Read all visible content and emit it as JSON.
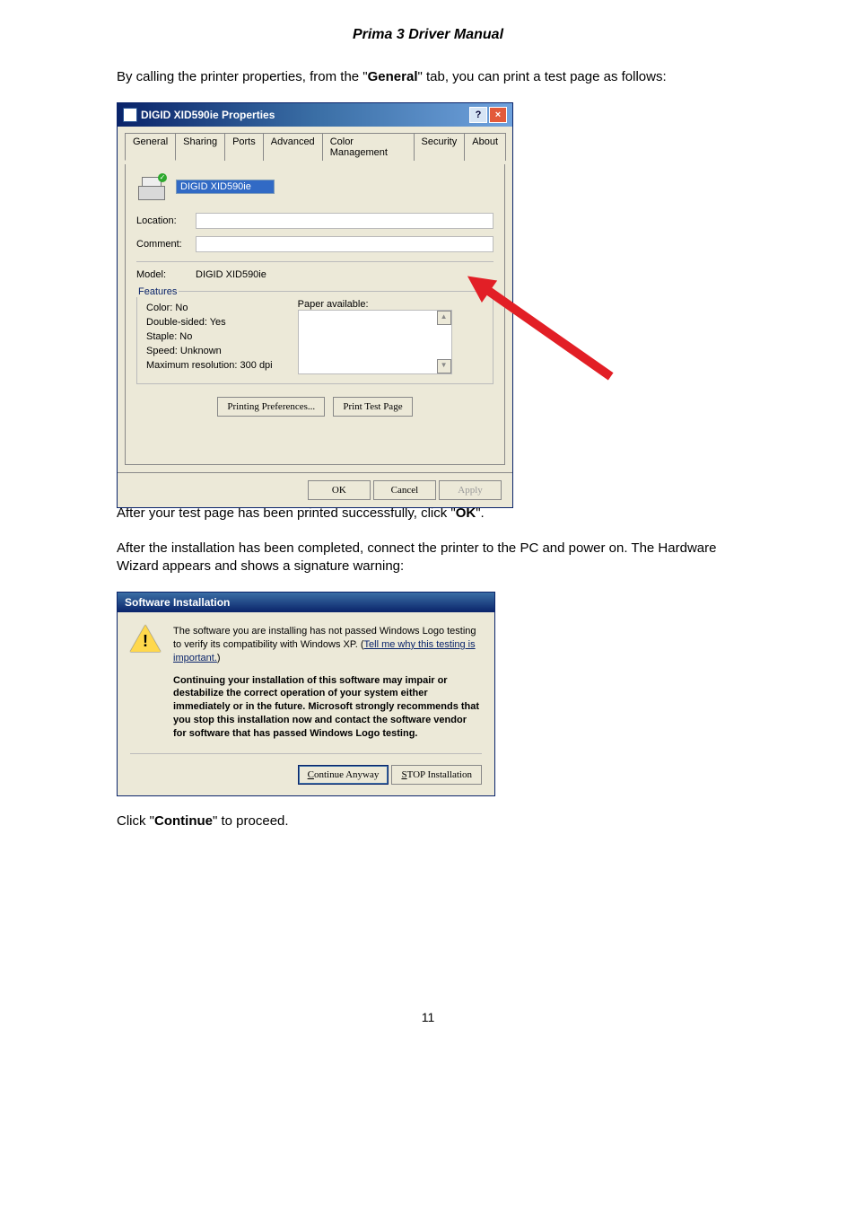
{
  "doc_title": "Prima 3 Driver Manual",
  "para1_pre": "By calling the printer properties, from the \"",
  "para1_bold": "General",
  "para1_post": "\" tab, you can print a test page as follows:",
  "para2_pre": "After your test page has been printed successfully, click \"",
  "para2_bold": "OK",
  "para2_post": "\".",
  "para3": "After the installation has been completed, connect the printer to the PC and power on. The Hardware Wizard appears and shows a signature warning:",
  "para4_pre": "Click \"",
  "para4_bold": "Continue",
  "para4_post": "\" to proceed.",
  "page_number": "11",
  "dlg_props": {
    "title": "DIGID XID590ie Properties",
    "help": "?",
    "close": "×",
    "tabs": {
      "general": "General",
      "sharing": "Sharing",
      "ports": "Ports",
      "advanced": "Advanced",
      "color": "Color Management",
      "security": "Security",
      "about": "About"
    },
    "name_value": "DIGID XID590ie",
    "location_label": "Location:",
    "comment_label": "Comment:",
    "model_label": "Model:",
    "model_value": "DIGID XID590ie",
    "features_label": "Features",
    "feat_color": "Color: No",
    "feat_double": "Double-sided: Yes",
    "feat_staple": "Staple: No",
    "feat_speed": "Speed: Unknown",
    "feat_res": "Maximum resolution: 300 dpi",
    "paper_label": "Paper available:",
    "btn_prefs": "Printing Preferences...",
    "btn_test": "Print Test Page",
    "btn_ok": "OK",
    "btn_cancel": "Cancel",
    "btn_apply": "Apply"
  },
  "dlg_soft": {
    "title": "Software Installation",
    "warn_mark": "!",
    "text1a": "The software you are installing has not passed Windows Logo testing to verify its compatibility with Windows XP. (",
    "text1_link": "Tell me why this testing is important.",
    "text1b": ")",
    "text2": "Continuing your installation of this software may impair or destabilize the correct operation of your system either immediately or in the future. Microsoft strongly recommends that you stop this installation now and contact the software vendor for software that has passed Windows Logo testing.",
    "btn_continue_u": "C",
    "btn_continue_rest": "ontinue Anyway",
    "btn_stop_u": "S",
    "btn_stop_rest": "TOP Installation"
  }
}
